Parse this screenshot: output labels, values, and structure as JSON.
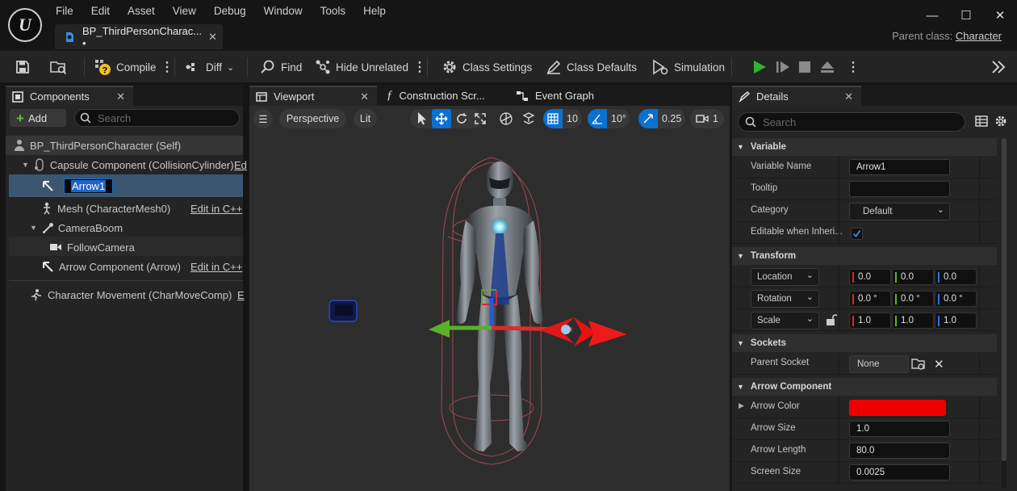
{
  "app": {
    "menu": [
      "File",
      "Edit",
      "Asset",
      "View",
      "Debug",
      "Window",
      "Tools",
      "Help"
    ],
    "doc_tab": "BP_ThirdPersonCharac...",
    "doc_tab_modified": "•",
    "parent_class_label": "Parent class:",
    "parent_class_value": "Character",
    "window_controls": {
      "minimize": "—",
      "maximize": "☐",
      "close": "✕"
    },
    "logo_text": "U"
  },
  "toolbar": {
    "compile": "Compile",
    "diff": "Diff",
    "find": "Find",
    "hide_unrelated": "Hide Unrelated",
    "class_settings": "Class Settings",
    "class_defaults": "Class Defaults",
    "simulation": "Simulation"
  },
  "components_panel": {
    "title": "Components",
    "add_label": "Add",
    "search_placeholder": "Search",
    "items": [
      {
        "label": "BP_ThirdPersonCharacter (Self)"
      },
      {
        "label": "Capsule Component (CollisionCylinder)",
        "edit": "Ed"
      },
      {
        "label": "Arrow1"
      },
      {
        "label": "Mesh (CharacterMesh0)",
        "edit": "Edit in C++"
      },
      {
        "label": "CameraBoom"
      },
      {
        "label": "FollowCamera"
      },
      {
        "label": "Arrow Component (Arrow)",
        "edit": "Edit in C++"
      },
      {
        "label": "Character Movement (CharMoveComp)",
        "edit": "E"
      }
    ]
  },
  "editor_tabs": {
    "viewport": "Viewport",
    "construction": "Construction Scr...",
    "event_graph": "Event Graph"
  },
  "viewport": {
    "perspective": "Perspective",
    "lit": "Lit",
    "grid_snap": "10",
    "rotation_snap": "10°",
    "scale_snap": "0.25",
    "camera_speed": "1"
  },
  "details": {
    "title": "Details",
    "search_placeholder": "Search",
    "variable": {
      "header": "Variable",
      "name_label": "Variable Name",
      "name_value": "Arrow1",
      "tooltip_label": "Tooltip",
      "tooltip_value": "",
      "category_label": "Category",
      "category_value": "Default",
      "editable_label": "Editable when Inheri..."
    },
    "transform": {
      "header": "Transform",
      "location_label": "Location",
      "location": [
        "0.0",
        "0.0",
        "0.0"
      ],
      "rotation_label": "Rotation",
      "rotation": [
        "0.0 °",
        "0.0 °",
        "0.0 °"
      ],
      "scale_label": "Scale",
      "scale": [
        "1.0",
        "1.0",
        "1.0"
      ]
    },
    "sockets": {
      "header": "Sockets",
      "parent_label": "Parent Socket",
      "parent_value": "None"
    },
    "arrow_component": {
      "header": "Arrow Component",
      "color_label": "Arrow Color",
      "color_value": "#ee0000",
      "size_label": "Arrow Size",
      "size_value": "1.0",
      "length_label": "Arrow Length",
      "length_value": "80.0",
      "screen_label": "Screen Size",
      "screen_value": "0.0025"
    }
  }
}
